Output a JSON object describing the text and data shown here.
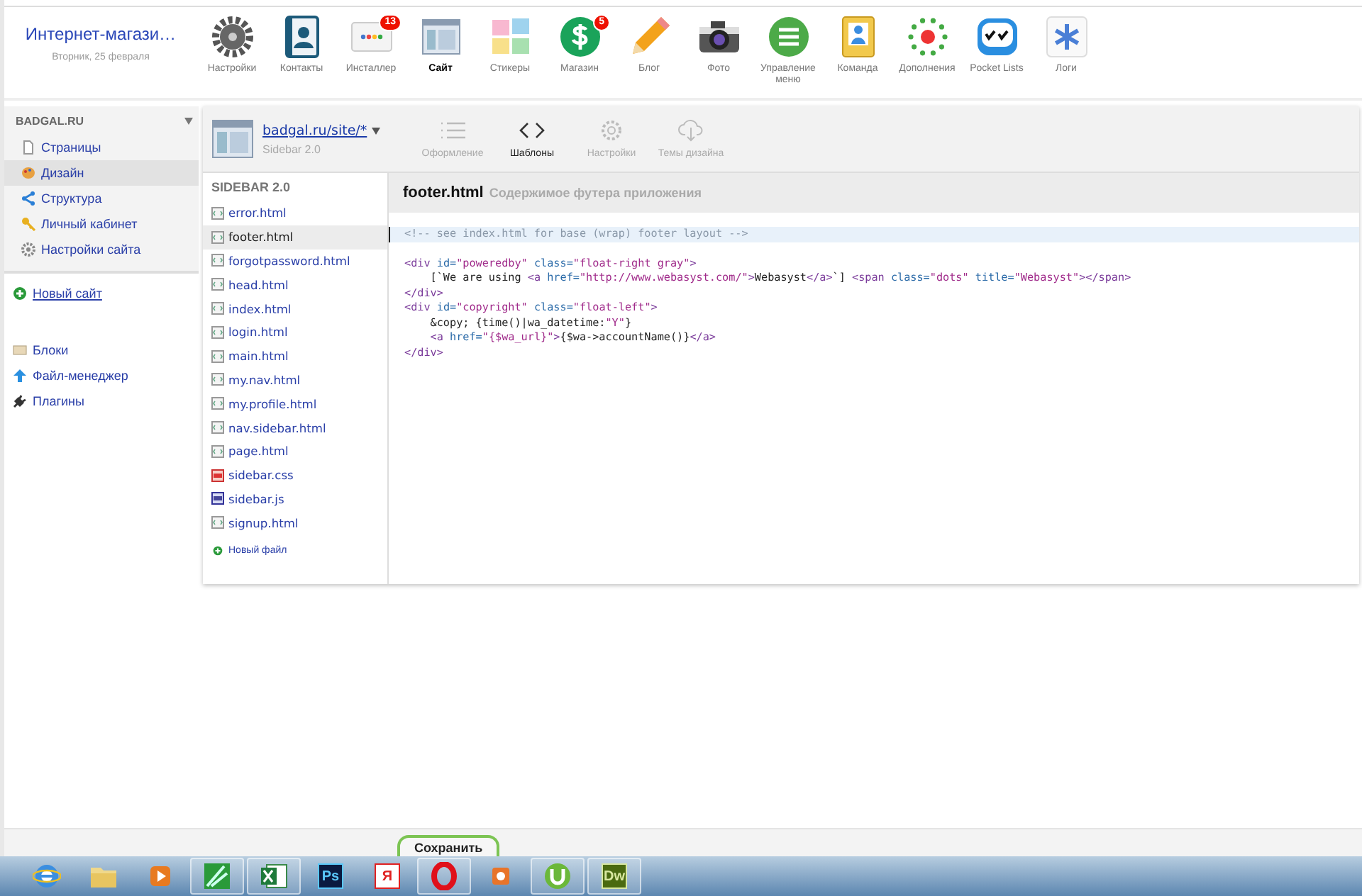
{
  "header": {
    "title": "Интернет-магази…",
    "date": "Вторник, 25 февраля"
  },
  "apps": [
    {
      "kind": "gear",
      "label": "Настройки",
      "selected": false
    },
    {
      "kind": "contacts",
      "label": "Контакты",
      "selected": false
    },
    {
      "kind": "installer",
      "label": "Инсталлер",
      "selected": false,
      "badge": "13"
    },
    {
      "kind": "site",
      "label": "Сайт",
      "selected": true
    },
    {
      "kind": "stickies",
      "label": "Стикеры",
      "selected": false
    },
    {
      "kind": "shop",
      "label": "Магазин",
      "selected": false,
      "badge": "5"
    },
    {
      "kind": "blog",
      "label": "Блог",
      "selected": false
    },
    {
      "kind": "photo",
      "label": "Фото",
      "selected": false
    },
    {
      "kind": "menu",
      "label": "Управление меню",
      "selected": false
    },
    {
      "kind": "team",
      "label": "Команда",
      "selected": false
    },
    {
      "kind": "addons",
      "label": "Дополнения",
      "selected": false
    },
    {
      "kind": "pocket",
      "label": "Pocket Lists",
      "selected": false
    },
    {
      "kind": "logs",
      "label": "Логи",
      "selected": false
    }
  ],
  "sidebar": {
    "domain": "BADGAL.RU",
    "items": [
      {
        "kind": "pages",
        "label": "Страницы",
        "selected": false
      },
      {
        "kind": "design",
        "label": "Дизайн",
        "selected": true
      },
      {
        "kind": "structure",
        "label": "Структура",
        "selected": false
      },
      {
        "kind": "account",
        "label": "Личный кабинет",
        "selected": false
      },
      {
        "kind": "settings",
        "label": "Настройки сайта",
        "selected": false
      }
    ],
    "new_site": "Новый сайт",
    "extra": [
      {
        "kind": "blocks",
        "label": "Блоки"
      },
      {
        "kind": "files",
        "label": "Файл-менеджер"
      },
      {
        "kind": "plugins",
        "label": "Плагины"
      }
    ]
  },
  "theme_panel": {
    "url": "badgal.ru/site/*",
    "theme": "Sidebar 2.0",
    "tabs": [
      {
        "kind": "list",
        "label": "Оформление",
        "selected": false
      },
      {
        "kind": "code",
        "label": "Шаблоны",
        "selected": true
      },
      {
        "kind": "gear",
        "label": "Настройки",
        "selected": false
      },
      {
        "kind": "cloud",
        "label": "Темы дизайна",
        "selected": false
      }
    ]
  },
  "files": {
    "heading": "SIDEBAR 2.0",
    "items": [
      {
        "kind": "html",
        "name": "error.html",
        "selected": false
      },
      {
        "kind": "html",
        "name": "footer.html",
        "selected": true
      },
      {
        "kind": "html",
        "name": "forgotpassword.html",
        "selected": false
      },
      {
        "kind": "html",
        "name": "head.html",
        "selected": false
      },
      {
        "kind": "html",
        "name": "index.html",
        "selected": false
      },
      {
        "kind": "html",
        "name": "login.html",
        "selected": false
      },
      {
        "kind": "html",
        "name": "main.html",
        "selected": false
      },
      {
        "kind": "html",
        "name": "my.nav.html",
        "selected": false
      },
      {
        "kind": "html",
        "name": "my.profile.html",
        "selected": false
      },
      {
        "kind": "html",
        "name": "nav.sidebar.html",
        "selected": false
      },
      {
        "kind": "html",
        "name": "page.html",
        "selected": false
      },
      {
        "kind": "css",
        "name": "sidebar.css",
        "selected": false
      },
      {
        "kind": "js",
        "name": "sidebar.js",
        "selected": false
      },
      {
        "kind": "html",
        "name": "signup.html",
        "selected": false
      }
    ],
    "new_file": "Новый файл"
  },
  "editor": {
    "file": "footer.html",
    "description": "Содержимое футера приложения",
    "lines": [
      {
        "current": true,
        "tokens": [
          {
            "kind": "comment",
            "text": "<!-- see index.html for base (wrap) footer layout -->"
          }
        ]
      },
      {
        "current": false,
        "space_before": true,
        "tokens": [
          {
            "kind": "tag",
            "text": "<div"
          },
          {
            "kind": "attr",
            "text": " id="
          },
          {
            "kind": "string",
            "text": "\"poweredby\""
          },
          {
            "kind": "attr",
            "text": " class="
          },
          {
            "kind": "string",
            "text": "\"float-right gray\""
          },
          {
            "kind": "tag",
            "text": ">"
          }
        ]
      },
      {
        "current": false,
        "tokens": [
          {
            "kind": "text",
            "text": "    [`We are using "
          },
          {
            "kind": "tag",
            "text": "<a"
          },
          {
            "kind": "attr",
            "text": " href="
          },
          {
            "kind": "string",
            "text": "\"http://www.webasyst.com/\""
          },
          {
            "kind": "tag",
            "text": ">"
          },
          {
            "kind": "text",
            "text": "Webasyst"
          },
          {
            "kind": "tag",
            "text": "</a>"
          },
          {
            "kind": "text",
            "text": "`] "
          },
          {
            "kind": "tag",
            "text": "<span"
          },
          {
            "kind": "attr",
            "text": " class="
          },
          {
            "kind": "string",
            "text": "\"dots\""
          },
          {
            "kind": "attr",
            "text": " title="
          },
          {
            "kind": "string",
            "text": "\"Webasyst\""
          },
          {
            "kind": "tag",
            "text": "></span>"
          }
        ]
      },
      {
        "current": false,
        "tokens": [
          {
            "kind": "tag",
            "text": "</div>"
          }
        ]
      },
      {
        "current": false,
        "tokens": [
          {
            "kind": "tag",
            "text": "<div"
          },
          {
            "kind": "attr",
            "text": " id="
          },
          {
            "kind": "string",
            "text": "\"copyright\""
          },
          {
            "kind": "attr",
            "text": " class="
          },
          {
            "kind": "string",
            "text": "\"float-left\""
          },
          {
            "kind": "tag",
            "text": ">"
          }
        ]
      },
      {
        "current": false,
        "tokens": [
          {
            "kind": "text",
            "text": "    &copy; {time()|wa_datetime:"
          },
          {
            "kind": "string",
            "text": "\"Y\""
          },
          {
            "kind": "text",
            "text": "}"
          }
        ]
      },
      {
        "current": false,
        "tokens": [
          {
            "kind": "tag",
            "text": "    <a"
          },
          {
            "kind": "attr",
            "text": " href="
          },
          {
            "kind": "string",
            "text": "\"{$wa_url}\""
          },
          {
            "kind": "tag",
            "text": ">"
          },
          {
            "kind": "text",
            "text": "{$wa->accountName()}"
          },
          {
            "kind": "tag",
            "text": "</a>"
          }
        ]
      },
      {
        "current": false,
        "tokens": [
          {
            "kind": "tag",
            "text": "</div>"
          }
        ]
      }
    ]
  },
  "save_button": "Сохранить",
  "taskbar": [
    {
      "kind": "ie",
      "running": false
    },
    {
      "kind": "folder",
      "running": false
    },
    {
      "kind": "player",
      "running": false
    },
    {
      "kind": "corel",
      "running": true
    },
    {
      "kind": "excel",
      "running": true
    },
    {
      "kind": "ps",
      "label": "Ps",
      "running": false
    },
    {
      "kind": "yandex",
      "label": "Я",
      "running": false
    },
    {
      "kind": "opera",
      "running": true
    },
    {
      "kind": "tool",
      "running": false
    },
    {
      "kind": "utorrent",
      "running": true
    },
    {
      "kind": "dw",
      "label": "Dw",
      "running": true
    }
  ]
}
